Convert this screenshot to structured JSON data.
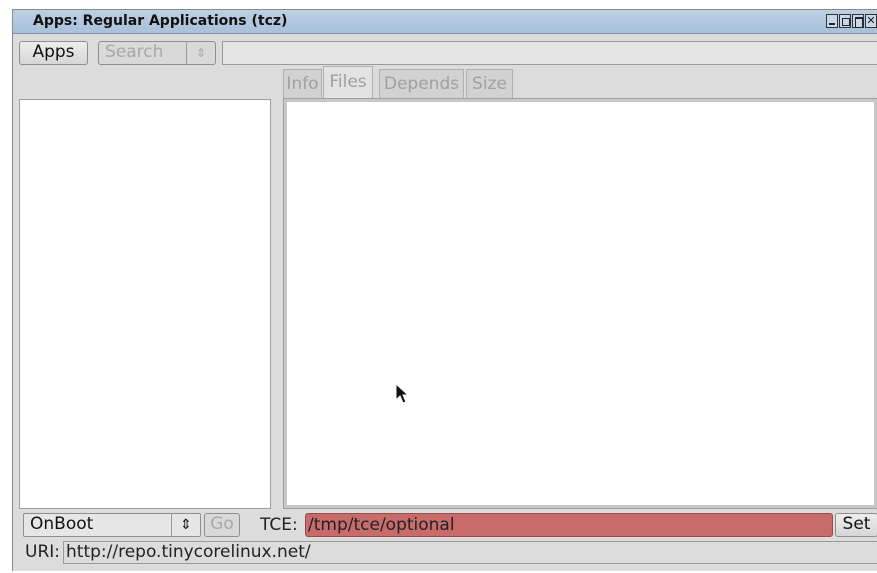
{
  "window": {
    "title": "Apps: Regular Applications (tcz)"
  },
  "toolbar": {
    "apps_label": "Apps",
    "search_label": "Search",
    "search_field_value": ""
  },
  "tabs": [
    {
      "label": "Info",
      "active": false
    },
    {
      "label": "Files",
      "active": true
    },
    {
      "label": "Depends",
      "active": false
    },
    {
      "label": "Size",
      "active": false
    }
  ],
  "bottom": {
    "mode_select_value": "OnBoot",
    "go_label": "Go",
    "tce_label": "TCE:",
    "tce_value": "/tmp/tce/optional",
    "set_label": "Set",
    "uri_label": "URI:",
    "uri_value": "http://repo.tinycorelinux.net/"
  },
  "colors": {
    "tce_field_bg": "#c86b6b",
    "titlebar": "#b5c9df"
  }
}
